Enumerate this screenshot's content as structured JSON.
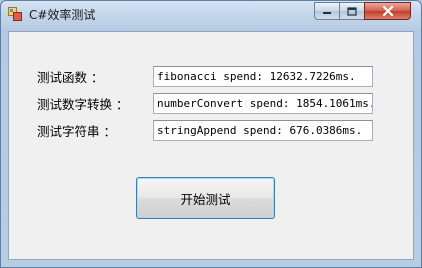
{
  "window": {
    "title": "C#效率测试"
  },
  "rows": [
    {
      "label": "测试函数 ：",
      "value": "fibonacci spend: 12632.7226ms."
    },
    {
      "label": "测试数字转换 ：",
      "value": "numberConvert spend: 1854.1061ms."
    },
    {
      "label": "测试字符串 ：",
      "value": "stringAppend spend: 676.0386ms."
    }
  ],
  "start_button": {
    "label": "开始测试"
  },
  "icons": {
    "app": "app-icon",
    "minimize": "minimize-icon",
    "maximize": "maximize-icon",
    "close": "close-icon"
  }
}
